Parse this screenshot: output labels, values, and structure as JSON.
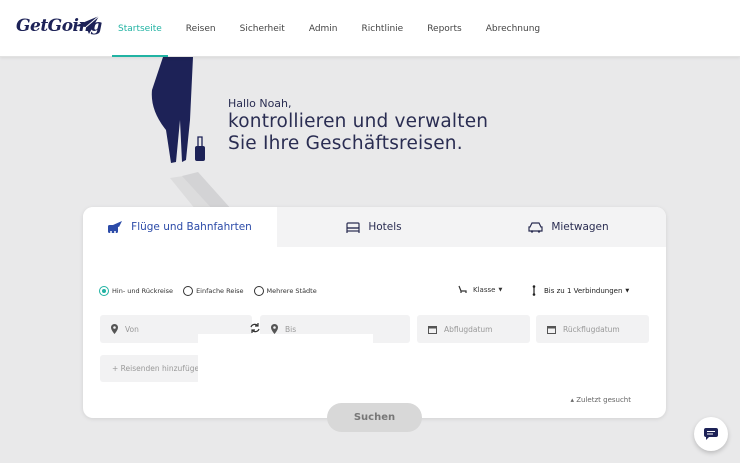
{
  "brand": {
    "logo_text": "GetGoing"
  },
  "nav": {
    "items": [
      {
        "label": "Startseite",
        "active": true
      },
      {
        "label": "Reisen"
      },
      {
        "label": "Sicherheit"
      },
      {
        "label": "Admin"
      },
      {
        "label": "Richtlinie"
      },
      {
        "label": "Reports"
      },
      {
        "label": "Abrechnung"
      }
    ]
  },
  "hero": {
    "greeting": "Hallo Noah,",
    "headline_line1": "kontrollieren und verwalten",
    "headline_line2": "Sie Ihre Geschäftsreisen."
  },
  "search": {
    "tabs": [
      {
        "label": "Flüge und Bahnfahrten",
        "active": true,
        "icon": "plane-train-icon"
      },
      {
        "label": "Hotels",
        "icon": "bed-icon"
      },
      {
        "label": "Mietwagen",
        "icon": "car-icon"
      }
    ],
    "trip_types": [
      {
        "label": "Hin- und Rückreise",
        "checked": true
      },
      {
        "label": "Einfache Reise"
      },
      {
        "label": "Mehrere Städte"
      }
    ],
    "class_label": "Klasse",
    "connections_label": "Bis zu 1 Verbindungen",
    "from_placeholder": "Von",
    "to_placeholder": "Bis",
    "depart_placeholder": "Abflugdatum",
    "return_placeholder": "Rückflugdatum",
    "add_travelers": "+ Reisenden hinzufüge",
    "recent_label": "▴ Zuletzt gesucht",
    "search_button": "Suchen"
  },
  "colors": {
    "accent": "#21b3a3",
    "primary": "#1d2257",
    "tab_active": "#2c4ba8"
  }
}
